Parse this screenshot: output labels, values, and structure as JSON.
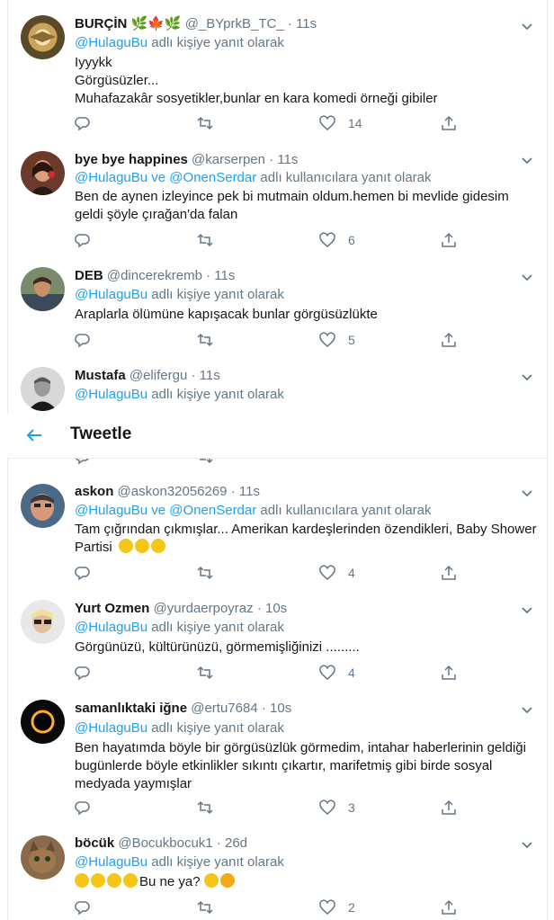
{
  "header": {
    "title": "Tweetle",
    "back_icon": "back-arrow-icon"
  },
  "reply_suffix_single": "adlı kişiye yanıt olarak",
  "reply_suffix_multi": "adlı kullanıcılara yanıt olarak",
  "colors": {
    "accent": "#1da1f2",
    "muted": "#657786",
    "text": "#14171a",
    "border": "#e6ecf0"
  },
  "tweets": [
    {
      "name": "BURÇİN 🌿🍁🌿",
      "handle": "@_BYprkB_TC_",
      "dot": "·",
      "time": "11s",
      "reply_to": "@HulaguBu",
      "reply_to_2": "",
      "reply_join": "",
      "reply_suffix": "adlı kişiye yanıt olarak",
      "lines": [
        "Iyyykk",
        "Görgüsüzler...",
        "Muhafazakâr sosyetikler,bunlar en kara komedi örneği gibiler"
      ],
      "likes": "14"
    },
    {
      "name": "bye bye happines",
      "handle": "@karserpen",
      "dot": "·",
      "time": "11s",
      "reply_to": "@HulaguBu",
      "reply_join": "ve",
      "reply_to_2": "@OnenSerdar",
      "reply_suffix": "adlı kullanıcılara yanıt olarak",
      "lines": [
        "Ben de aynen izleyince pek bi mutmain oldum.hemen bi mevlide gidesim",
        "geldi  şöyle çırağan'da falan"
      ],
      "likes": "6"
    },
    {
      "name": "DEB",
      "handle": "@dincerekremb",
      "dot": "·",
      "time": "11s",
      "reply_to": "@HulaguBu",
      "reply_suffix": "adlı kişiye yanıt olarak",
      "lines": [
        "Araplarla ölümüne kapışacak bunlar görgüsüzlükte"
      ],
      "likes": "5"
    },
    {
      "name": "Mustafa",
      "handle": "@elifergu",
      "dot": "·",
      "time": "11s",
      "reply_to": "@HulaguBu",
      "reply_suffix": "adlı kişiye yanıt olarak",
      "lines": [],
      "likes": ""
    },
    {
      "name": "askon",
      "handle": "@askon32056269",
      "dot": "·",
      "time": "11s",
      "reply_to": "@HulaguBu",
      "reply_join": "ve",
      "reply_to_2": "@OnenSerdar",
      "reply_suffix": "adlı kullanıcılara yanıt olarak",
      "lines": [
        "Tam çığrından çıkmışlar... Amerikan kardeşlerinden özendikleri, Baby Shower",
        "Partisi"
      ],
      "likes": "4"
    },
    {
      "name": "Yurt Ozmen",
      "handle": "@yurdaerpoyraz",
      "dot": "·",
      "time": "10s",
      "reply_to": "@HulaguBu",
      "reply_suffix": "adlı kişiye yanıt olarak",
      "lines": [
        "Görgünüzü, kültürünüzü, görmemişliğinizi ........."
      ],
      "likes": "4"
    },
    {
      "name": "samanlıktaki iğne",
      "handle": "@ertu7684",
      "dot": "·",
      "time": "10s",
      "reply_to": "@HulaguBu",
      "reply_suffix": "adlı kişiye yanıt olarak",
      "lines": [
        "Ben hayatımda böyle bir görgüsüzlük görmedim, intahar haberlerinin geldiği",
        "bugünlerde böyle etkinlikler sıkıntı çıkartır, marifetmiş gibi birde sosyal",
        "medyada yaymışlar"
      ],
      "likes": "3"
    },
    {
      "name": "böcük",
      "handle": "@Bocukbocuk1",
      "dot": "·",
      "time": "26d",
      "reply_to": "@HulaguBu",
      "reply_suffix": "adlı kişiye yanıt olarak",
      "lines": [
        "Bu ne ya?"
      ],
      "likes": "2"
    }
  ]
}
